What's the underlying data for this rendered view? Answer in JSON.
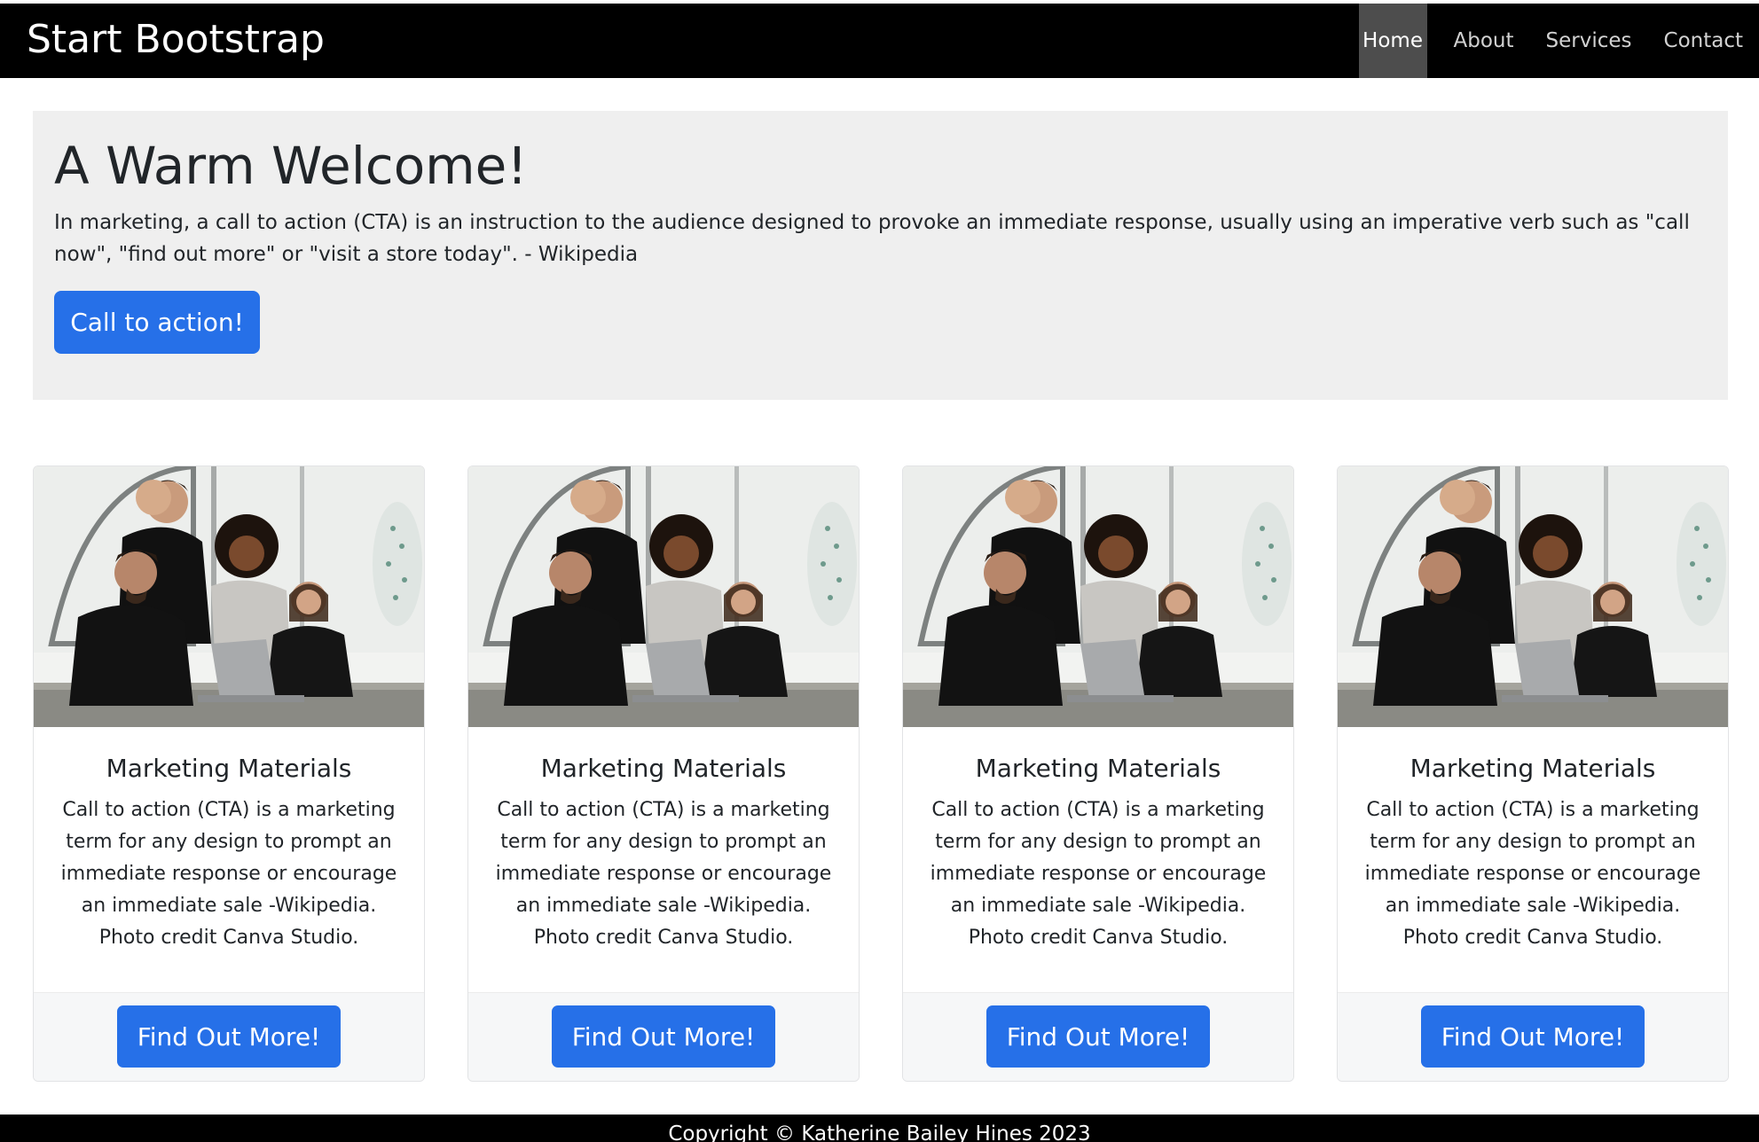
{
  "navbar": {
    "brand": "Start Bootstrap",
    "links": [
      "Home",
      "About",
      "Services",
      "Contact"
    ],
    "active": "Home"
  },
  "hero": {
    "title": "A Warm Welcome!",
    "text": "In marketing, a call to action (CTA) is an instruction to the audience designed to provoke an immediate response, usually using an imperative verb such as \"call now\", \"find out more\" or \"visit a store today\". - Wikipedia",
    "button_label": "Call to action!"
  },
  "cards": [
    {
      "title": "Marketing Materials",
      "text": "Call to action (CTA) is a marketing term for any design to prompt an immediate response or encourage an immediate sale -Wikipedia. Photo credit Canva Studio.",
      "button_label": "Find Out More!"
    },
    {
      "title": "Marketing Materials",
      "text": "Call to action (CTA) is a marketing term for any design to prompt an immediate response or encourage an immediate sale -Wikipedia. Photo credit Canva Studio.",
      "button_label": "Find Out More!"
    },
    {
      "title": "Marketing Materials",
      "text": "Call to action (CTA) is a marketing term for any design to prompt an immediate response or encourage an immediate sale -Wikipedia. Photo credit Canva Studio.",
      "button_label": "Find Out More!"
    },
    {
      "title": "Marketing Materials",
      "text": "Call to action (CTA) is a marketing term for any design to prompt an immediate response or encourage an immediate sale -Wikipedia. Photo credit Canva Studio.",
      "button_label": "Find Out More!"
    }
  ],
  "footer": {
    "text": "Copyright © Katherine Bailey Hines 2023"
  },
  "colors": {
    "navbar_bg": "#000000",
    "active_nav_bg": "#4d4d4d",
    "primary": "#2670e8",
    "hero_bg": "#efefef"
  }
}
